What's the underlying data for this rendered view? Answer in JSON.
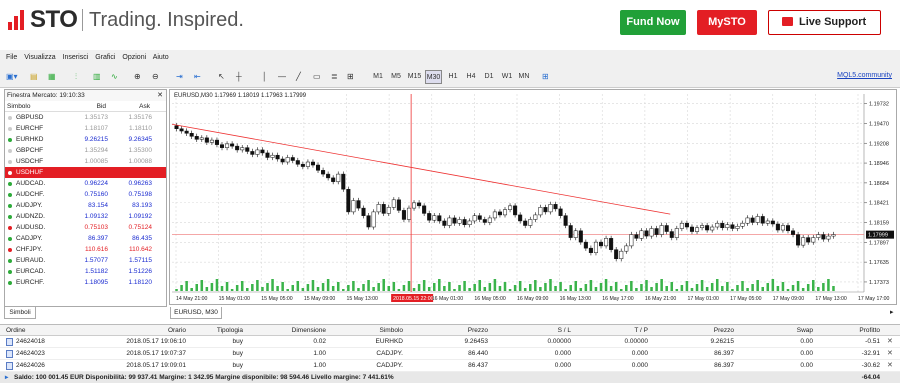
{
  "brand": {
    "logo": "STO",
    "tagline": "Trading. Inspired."
  },
  "header": {
    "fund_now": "Fund Now",
    "mysto": "MySTO",
    "live_support": "Live Support"
  },
  "menu": [
    "File",
    "Visualizza",
    "Inserisci",
    "Grafici",
    "Opzioni",
    "Aiuto"
  ],
  "timeframes": [
    "M1",
    "M5",
    "M15",
    "M30",
    "H1",
    "H4",
    "D1",
    "W1",
    "MN"
  ],
  "mql_link": "MQL5.community",
  "market_watch": {
    "title": "Finestra Mercato: 19:10:33",
    "col_symbol": "Simbolo",
    "col_bid": "Bid",
    "col_ask": "Ask",
    "tab": "Simboli",
    "rows": [
      {
        "symbol": "GBPUSD",
        "bid": "1.35173",
        "ask": "1.35176",
        "color": "#999999",
        "dot": "#cccccc",
        "highlight": false
      },
      {
        "symbol": "EURCHF",
        "bid": "1.18107",
        "ask": "1.18110",
        "color": "#999999",
        "dot": "#cccccc",
        "highlight": false
      },
      {
        "symbol": "EURHKD",
        "bid": "9.26215",
        "ask": "9.26345",
        "color": "#1a2bd0",
        "dot": "#2eaa3a",
        "highlight": false
      },
      {
        "symbol": "GBPCHF",
        "bid": "1.35294",
        "ask": "1.35300",
        "color": "#999999",
        "dot": "#cccccc",
        "highlight": false
      },
      {
        "symbol": "USDCHF",
        "bid": "1.00085",
        "ask": "1.00088",
        "color": "#999999",
        "dot": "#cccccc",
        "highlight": false
      },
      {
        "symbol": "USDHUF",
        "bid": "",
        "ask": "",
        "color": "#ffffff",
        "dot": "#ffffff",
        "highlight": true
      },
      {
        "symbol": "AUDCAD.",
        "bid": "0.96224",
        "ask": "0.96263",
        "color": "#1a2bd0",
        "dot": "#2eaa3a",
        "highlight": false
      },
      {
        "symbol": "AUDCHF.",
        "bid": "0.75160",
        "ask": "0.75198",
        "color": "#1a2bd0",
        "dot": "#2eaa3a",
        "highlight": false
      },
      {
        "symbol": "AUDJPY.",
        "bid": "83.154",
        "ask": "83.193",
        "color": "#1a2bd0",
        "dot": "#2eaa3a",
        "highlight": false
      },
      {
        "symbol": "AUDNZD.",
        "bid": "1.09132",
        "ask": "1.09192",
        "color": "#1a2bd0",
        "dot": "#2eaa3a",
        "highlight": false
      },
      {
        "symbol": "AUDUSD.",
        "bid": "0.75103",
        "ask": "0.75124",
        "color": "#e31e24",
        "dot": "#e31e24",
        "highlight": false
      },
      {
        "symbol": "CADJPY.",
        "bid": "86.397",
        "ask": "86.435",
        "color": "#1a2bd0",
        "dot": "#2eaa3a",
        "highlight": false
      },
      {
        "symbol": "CHFJPY.",
        "bid": "110.616",
        "ask": "110.642",
        "color": "#e31e24",
        "dot": "#e31e24",
        "highlight": false
      },
      {
        "symbol": "EURAUD.",
        "bid": "1.57077",
        "ask": "1.57115",
        "color": "#1a2bd0",
        "dot": "#2eaa3a",
        "highlight": false
      },
      {
        "symbol": "EURCAD.",
        "bid": "1.51182",
        "ask": "1.51226",
        "color": "#1a2bd0",
        "dot": "#2eaa3a",
        "highlight": false
      },
      {
        "symbol": "EURCHF.",
        "bid": "1.18095",
        "ask": "1.18120",
        "color": "#1a2bd0",
        "dot": "#2eaa3a",
        "highlight": false
      }
    ]
  },
  "chart": {
    "title": "EURUSD,M30  1.17969 1.18019 1.17963 1.17999",
    "tab": "EURUSD, M30",
    "price_labels": [
      "1.19732",
      "1.19470",
      "1.19208",
      "1.18946",
      "1.18684",
      "1.18421",
      "1.18159",
      "1.17897",
      "1.17635",
      "1.17373"
    ],
    "current_price": "1.17999",
    "time_labels": [
      "14 May 21:00",
      "15 May 01:00",
      "15 May 05:00",
      "15 May 09:00",
      "15 May 13:00",
      "2018.05.15 22:00",
      "16 May 01:00",
      "16 May 05:00",
      "16 May 09:00",
      "16 May 13:00",
      "16 May 17:00",
      "16 May 21:00",
      "17 May 01:00",
      "17 May 05:00",
      "17 May 09:00",
      "17 May 13:00",
      "17 May 17:00"
    ],
    "crosshair_time_index": 5,
    "ylim": [
      1.1724,
      1.1986
    ],
    "closes": [
      1.194,
      1.1937,
      1.1934,
      1.193,
      1.1926,
      1.1928,
      1.1922,
      1.1925,
      1.1919,
      1.1915,
      1.192,
      1.1917,
      1.1912,
      1.1915,
      1.191,
      1.1906,
      1.1912,
      1.1908,
      1.1902,
      1.1905,
      1.19,
      1.1896,
      1.1902,
      1.1898,
      1.1893,
      1.189,
      1.1896,
      1.1892,
      1.1885,
      1.188,
      1.1875,
      1.187,
      1.188,
      1.186,
      1.183,
      1.1845,
      1.1835,
      1.1825,
      1.181,
      1.183,
      1.184,
      1.1828,
      1.1836,
      1.1846,
      1.1832,
      1.182,
      1.1835,
      1.1842,
      1.1838,
      1.1828,
      1.1819,
      1.1825,
      1.1818,
      1.1812,
      1.1822,
      1.1815,
      1.182,
      1.1813,
      1.1818,
      1.1825,
      1.182,
      1.1816,
      1.1822,
      1.183,
      1.1826,
      1.1833,
      1.1838,
      1.1826,
      1.1818,
      1.1812,
      1.182,
      1.1826,
      1.1836,
      1.183,
      1.184,
      1.1834,
      1.1825,
      1.1812,
      1.1796,
      1.1805,
      1.179,
      1.1782,
      1.1776,
      1.179,
      1.1785,
      1.1795,
      1.178,
      1.1768,
      1.1778,
      1.1785,
      1.18,
      1.1795,
      1.1805,
      1.1798,
      1.1808,
      1.18,
      1.1812,
      1.1804,
      1.1796,
      1.1808,
      1.1815,
      1.181,
      1.1804,
      1.1809,
      1.1812,
      1.1806,
      1.181,
      1.1815,
      1.1809,
      1.1813,
      1.1808,
      1.1811,
      1.1815,
      1.1822,
      1.1816,
      1.1824,
      1.1815,
      1.1818,
      1.1814,
      1.1806,
      1.1812,
      1.1805,
      1.18,
      1.1786,
      1.1796,
      1.179,
      1.1796,
      1.18,
      1.1794,
      1.1798,
      1.18
    ],
    "trendline": [
      [
        0.0,
        1.1946
      ],
      [
        0.72,
        1.1827
      ]
    ]
  },
  "orders": {
    "headers": [
      "Ordine",
      "Orario",
      "Tipologia",
      "Dimensione",
      "Simbolo",
      "Prezzo",
      "S / L",
      "T / P",
      "Prezzo",
      "Swap",
      "Profitto"
    ],
    "rows": [
      [
        "24624018",
        "2018.05.17 19:06:10",
        "buy",
        "0.02",
        "EURHKD",
        "9.26453",
        "0.00000",
        "0.00000",
        "9.26215",
        "0.00",
        "-0.51"
      ],
      [
        "24624023",
        "2018.05.17 19:07:37",
        "buy",
        "1.00",
        "CADJPY.",
        "86.440",
        "0.000",
        "0.000",
        "86.397",
        "0.00",
        "-32.91"
      ],
      [
        "24624026",
        "2018.05.17 19:09:01",
        "buy",
        "1.00",
        "CADJPY.",
        "86.437",
        "0.000",
        "0.000",
        "86.397",
        "0.00",
        "-30.62"
      ]
    ],
    "balance_line": "Saldo: 100 001.45 EUR  Disponibilità: 99 937.41  Margine: 1 342.95  Margine disponibile: 98 594.46  Livello margine: 7 441.61%",
    "balance_total": "-64.04"
  }
}
